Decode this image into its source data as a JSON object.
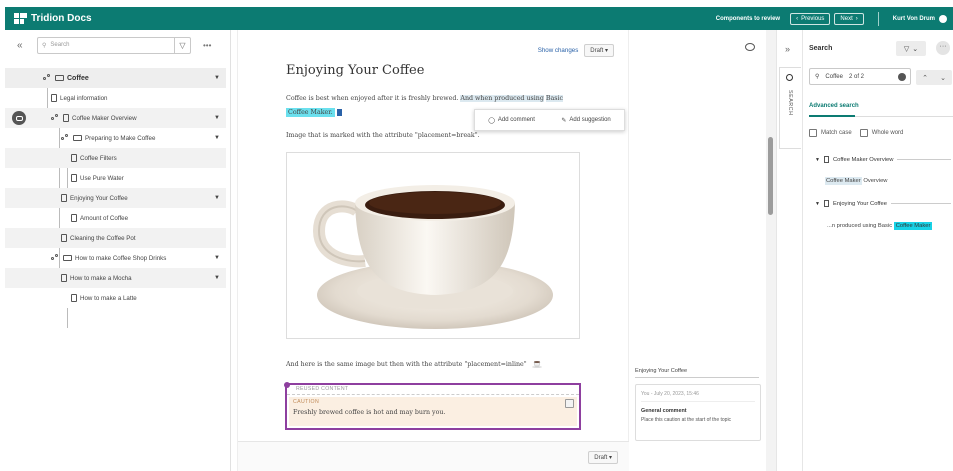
{
  "app": {
    "title": "Tridion Docs"
  },
  "topbar": {
    "components_to_review": "Components to review",
    "previous_label": "Previous",
    "next_label": "Next",
    "user_name": "Kurt Von Drum"
  },
  "sidebar": {
    "search_placeholder": "Search",
    "more": "•••",
    "items": [
      {
        "label": "Coffee",
        "level": 0,
        "kind": "folder",
        "expandable": true
      },
      {
        "label": "Legal information",
        "level": 1,
        "kind": "doc",
        "expandable": false
      },
      {
        "label": "Coffee Maker Overview",
        "level": 1,
        "kind": "doc",
        "expandable": true
      },
      {
        "label": "Preparing to Make Coffee",
        "level": 2,
        "kind": "folder",
        "expandable": true
      },
      {
        "label": "Coffee Filters",
        "level": 3,
        "kind": "doc",
        "expandable": false
      },
      {
        "label": "Use Pure Water",
        "level": 3,
        "kind": "doc",
        "expandable": false
      },
      {
        "label": "Enjoying Your Coffee",
        "level": 2,
        "kind": "doc",
        "expandable": true
      },
      {
        "label": "Amount of Coffee",
        "level": 3,
        "kind": "doc",
        "expandable": false
      },
      {
        "label": "Cleaning the Coffee Pot",
        "level": 2,
        "kind": "doc",
        "expandable": false
      },
      {
        "label": "How to make Coffee Shop Drinks",
        "level": 1,
        "kind": "folder",
        "expandable": true
      },
      {
        "label": "How to make a Mocha",
        "level": 2,
        "kind": "doc",
        "expandable": true
      },
      {
        "label": "How to make a Latte",
        "level": 2,
        "kind": "doc",
        "expandable": false
      }
    ]
  },
  "editor": {
    "show_changes": "Show changes",
    "draft_label": "Draft",
    "title": "Enjoying Your Coffee",
    "para1_a": "Coffee is best when enjoyed after it is freshly brewed.",
    "para1_b": "And when produced using",
    "para1_c": "Basic",
    "para1_d": "Coffee Maker.",
    "para2": "Image that is marked with the attribute \"placement=break\".",
    "popup_add_comment": "Add comment",
    "popup_add_suggestion": "Add suggestion",
    "para3": "And here is the same image but then with the attribute \"placement=inline\"",
    "reused_label": "REUSED CONTENT",
    "caution_label": "CAUTION",
    "caution_text": "Freshly brewed coffee is hot and may burn you."
  },
  "comments": {
    "heading": "Enjoying Your Coffee",
    "meta": "You - July 20, 2023, 15:46",
    "title": "General comment",
    "body": "Place this caution at the start of the topic"
  },
  "search_panel": {
    "title": "Search",
    "query": "Coffee",
    "count": "2 of 2",
    "advanced": "Advanced search",
    "match_case": "Match case",
    "whole_word": "Whole word",
    "rail_label": "SEARCH",
    "results": [
      {
        "doc": "Coffee Maker Overview",
        "snippet_hl": "Coffee Maker",
        "snippet_rest": "Overview"
      },
      {
        "doc": "Enjoying Your Coffee",
        "snippet_pre": "...n produced using Basic",
        "snippet_hl": "Coffee Maker"
      }
    ]
  }
}
